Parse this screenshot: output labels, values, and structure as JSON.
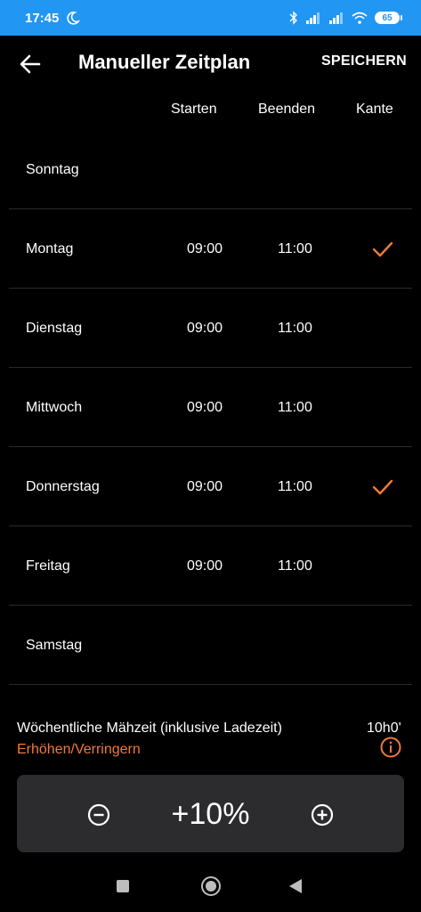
{
  "status": {
    "time": "17:45",
    "battery": "65"
  },
  "appbar": {
    "title": "Manueller Zeitplan",
    "save_label": "SPEICHERN"
  },
  "columns": {
    "start": "Starten",
    "end": "Beenden",
    "edge": "Kante"
  },
  "days": [
    {
      "name": "Sonntag",
      "start": "",
      "end": "",
      "edge": false
    },
    {
      "name": "Montag",
      "start": "09:00",
      "end": "11:00",
      "edge": true
    },
    {
      "name": "Dienstag",
      "start": "09:00",
      "end": "11:00",
      "edge": false
    },
    {
      "name": "Mittwoch",
      "start": "09:00",
      "end": "11:00",
      "edge": false
    },
    {
      "name": "Donnerstag",
      "start": "09:00",
      "end": "11:00",
      "edge": true
    },
    {
      "name": "Freitag",
      "start": "09:00",
      "end": "11:00",
      "edge": false
    },
    {
      "name": "Samstag",
      "start": "",
      "end": "",
      "edge": false
    }
  ],
  "weekly": {
    "label": "Wöchentliche Mähzeit (inklusive Ladezeit)",
    "value": "10h0'",
    "adjust_link": "Erhöhen/Verringern"
  },
  "adjust": {
    "percent": "+10%"
  },
  "colors": {
    "accent": "#ef7a3a",
    "statusbar": "#2196f3",
    "panel": "#2c2c2e"
  },
  "icons": {
    "back": "arrow-left-icon",
    "check": "checkmark-icon",
    "info": "info-icon",
    "minus": "minus-circle-icon",
    "plus": "plus-circle-icon",
    "moon": "moon-icon",
    "bluetooth": "bluetooth-icon",
    "signal": "signal-icon",
    "wifi": "wifi-icon"
  }
}
